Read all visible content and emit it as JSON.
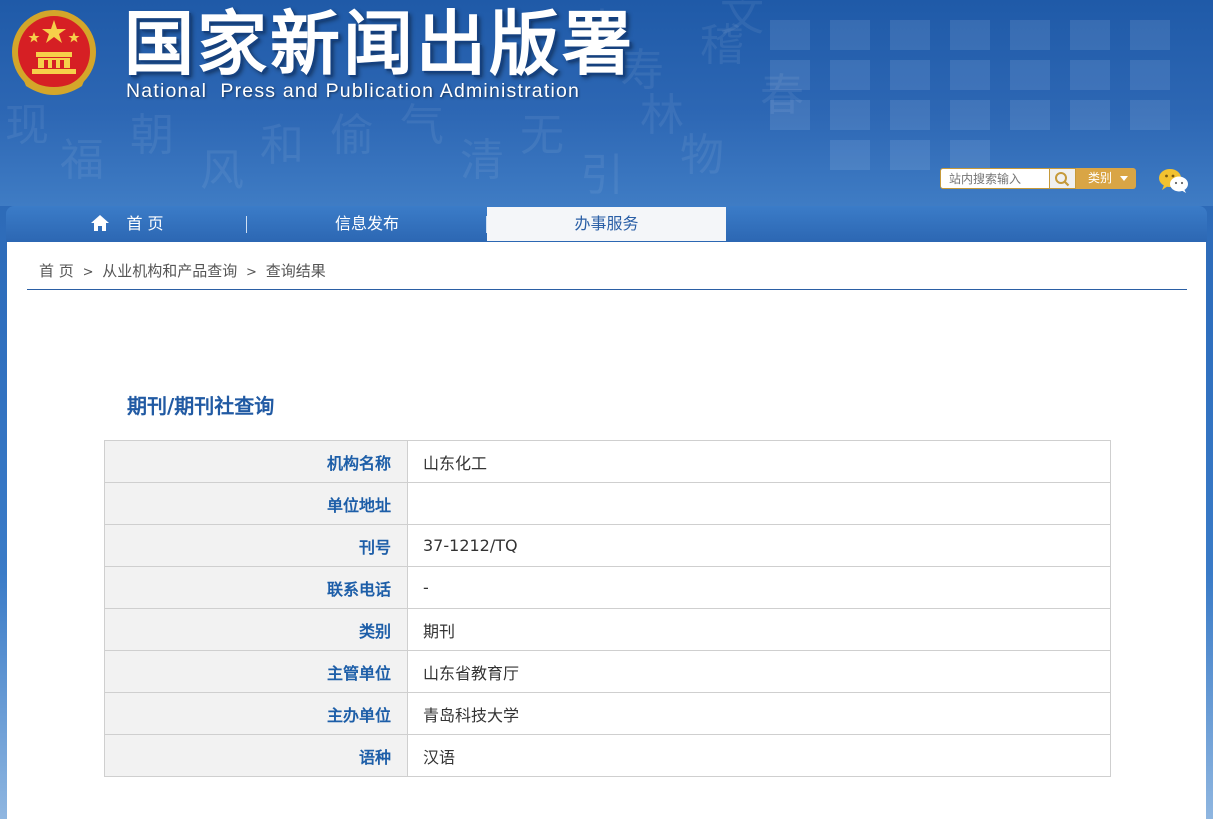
{
  "header": {
    "title_cn": "国家新闻出版署",
    "title_en": "National  Press and Publication Administration",
    "search_placeholder": "站内搜索输入",
    "category_label": "类别"
  },
  "nav": {
    "items": [
      {
        "label": "首 页",
        "icon": "home-icon"
      },
      {
        "label": "信息发布"
      },
      {
        "label": "办事服务",
        "active": true
      }
    ]
  },
  "breadcrumb": {
    "home": "首 页",
    "sep": ">",
    "level2": "从业机构和产品查询",
    "level3": "查询结果"
  },
  "page_title": "期刊/期刊社查询",
  "table": {
    "rows": [
      {
        "label": "机构名称",
        "value": "山东化工"
      },
      {
        "label": "单位地址",
        "value": ""
      },
      {
        "label": "刊号",
        "value": "37-1212/TQ"
      },
      {
        "label": "联系电话",
        "value": "-"
      },
      {
        "label": "类别",
        "value": "期刊"
      },
      {
        "label": "主管单位",
        "value": "山东省教育厅"
      },
      {
        "label": "主办单位",
        "value": "青岛科技大学"
      },
      {
        "label": "语种",
        "value": "汉语"
      }
    ]
  },
  "colors": {
    "header_blue": "#2d67b4",
    "accent_gold": "#d9a545",
    "label_blue": "#1d5ea8"
  }
}
